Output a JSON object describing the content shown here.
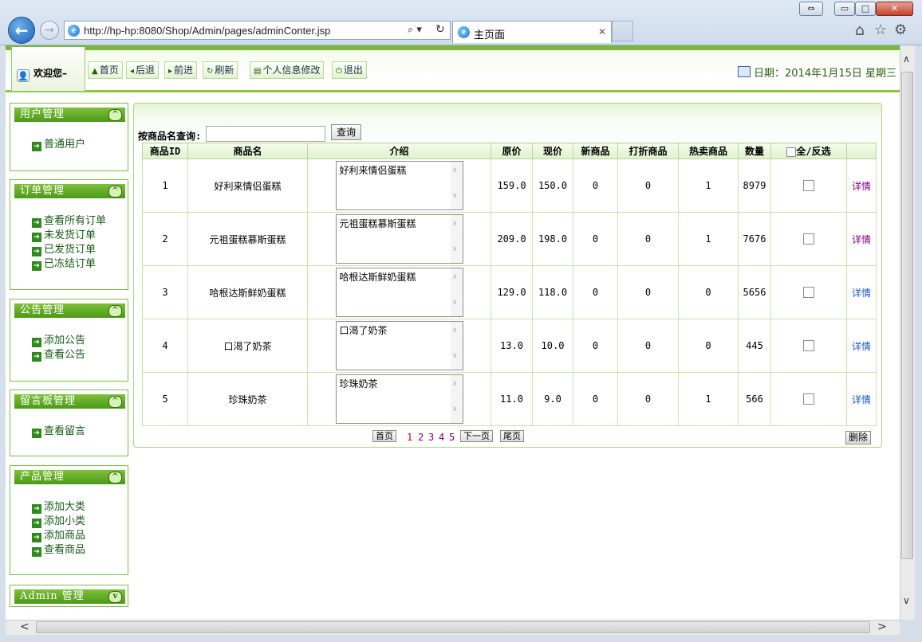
{
  "browser": {
    "url": "http://hp-hp:8080/Shop/Admin/pages/adminConter.jsp",
    "tab_title": "主页面",
    "search_glyph": "⌕ ▾",
    "refresh_glyph": "↻",
    "tab_close": "✕",
    "home_icon": "⌂",
    "star_icon": "☆",
    "gear_icon": "⚙",
    "minimize": "▭",
    "maximize": "□",
    "close": "✕",
    "restore": "⇔"
  },
  "header": {
    "welcome": "欢迎您–",
    "toolbar": [
      {
        "icon": "▲",
        "label": "首页"
      },
      {
        "icon": "◂",
        "label": "后退"
      },
      {
        "icon": "▸",
        "label": "前进"
      },
      {
        "icon": "↻",
        "label": "刷新"
      },
      {
        "icon": "▤",
        "label": "个人信息修改"
      },
      {
        "icon": "⏻",
        "label": "退出"
      }
    ],
    "date": "日期：2014年1月15日 星期三"
  },
  "sidebar": [
    {
      "title": "用户管理",
      "toggle": "^",
      "items": [
        "普通用户"
      ]
    },
    {
      "title": "订单管理",
      "toggle": "^",
      "items": [
        "查看所有订单",
        "未发货订单",
        "已发货订单",
        "已冻结订单"
      ]
    },
    {
      "title": "公告管理",
      "toggle": "^",
      "items": [
        "添加公告",
        "查看公告"
      ]
    },
    {
      "title": "留言板管理",
      "toggle": "^",
      "items": [
        "查看留言"
      ]
    },
    {
      "title": "产品管理",
      "toggle": "^",
      "items": [
        "添加大类",
        "添加小类",
        "添加商品",
        "查看商品"
      ]
    },
    {
      "title": "Admin 管理",
      "toggle": "v",
      "items": []
    }
  ],
  "search": {
    "label": "按商品名查询:",
    "value": "",
    "button": "查询"
  },
  "table": {
    "headers": [
      "商品ID",
      "商品名",
      "介绍",
      "原价",
      "现价",
      "新商品",
      "打折商品",
      "热卖商品",
      "数量",
      "全/反选",
      ""
    ],
    "rows": [
      {
        "id": "1",
        "name": "好利来情侣蛋糕",
        "intro": "好利来情侣蛋糕",
        "orig": "159.0",
        "price": "150.0",
        "new": "0",
        "discount": "0",
        "hot": "1",
        "qty": "8979",
        "detail": "详情"
      },
      {
        "id": "2",
        "name": "元祖蛋糕慕斯蛋糕",
        "intro": "元祖蛋糕慕斯蛋糕",
        "orig": "209.0",
        "price": "198.0",
        "new": "0",
        "discount": "0",
        "hot": "1",
        "qty": "7676",
        "detail": "详情"
      },
      {
        "id": "3",
        "name": "哈根达斯鲜奶蛋糕",
        "intro": "哈根达斯鲜奶蛋糕",
        "orig": "129.0",
        "price": "118.0",
        "new": "0",
        "discount": "0",
        "hot": "0",
        "qty": "5656",
        "detail": "详情"
      },
      {
        "id": "4",
        "name": "口渴了奶茶",
        "intro": "口渴了奶茶",
        "orig": "13.0",
        "price": "10.0",
        "new": "0",
        "discount": "0",
        "hot": "0",
        "qty": "445",
        "detail": "详情"
      },
      {
        "id": "5",
        "name": "珍珠奶茶",
        "intro": "珍珠奶茶",
        "orig": "11.0",
        "price": "9.0",
        "new": "0",
        "discount": "0",
        "hot": "1",
        "qty": "566",
        "detail": "详情"
      }
    ]
  },
  "pager": {
    "first": "首页",
    "pages": [
      "1",
      "2",
      "3",
      "4",
      "5"
    ],
    "next": "下一页",
    "last": "尾页"
  },
  "delete_button": "删除",
  "colors": {
    "accent_green": "#4a9a16",
    "link_blue": "#1a55c0",
    "visited_purple": "#800080",
    "page_number_active": "#c0001a"
  }
}
